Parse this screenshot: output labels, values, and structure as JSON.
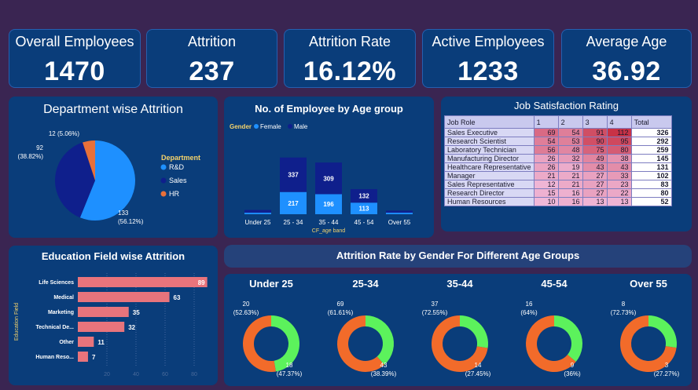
{
  "kpis": [
    {
      "label": "Overall Employees",
      "value": "1470"
    },
    {
      "label": "Attrition",
      "value": "237"
    },
    {
      "label": "Attrition Rate",
      "value": "16.12%"
    },
    {
      "label": "Active Employees",
      "value": "1233"
    },
    {
      "label": "Average Age",
      "value": "36.92"
    }
  ],
  "panels": {
    "dept": "Department wise Attrition",
    "age_group": "No. of Employee by Age group",
    "job_sat": "Job Satisfaction Rating",
    "edu": "Education Field wise Attrition",
    "gender_age": "Attrition Rate by Gender For Different Age Groups"
  },
  "colors": {
    "female": "#1e90ff",
    "male": "#0f1f8c",
    "hr": "#e8703a",
    "bar": "#e8747c",
    "donut_orange": "#f26b2a",
    "donut_green": "#5cf25c"
  },
  "chart_data": [
    {
      "id": "dept",
      "type": "pie",
      "legend_title": "Department",
      "legend_position": "right",
      "slices": [
        {
          "name": "R&D",
          "value": 133,
          "label": "133",
          "pct": "(56.12%)",
          "color": "#1e90ff"
        },
        {
          "name": "Sales",
          "value": 92,
          "label": "92",
          "pct": "(38.82%)",
          "color": "#0f1f8c"
        },
        {
          "name": "HR",
          "value": 12,
          "label": "12 (5.06%)",
          "pct": "",
          "color": "#e8703a"
        }
      ]
    },
    {
      "id": "age_group",
      "type": "bar",
      "stacked": true,
      "legend_title": "Gender",
      "legend_position": "top-left",
      "xlabel": "CF_age band",
      "categories": [
        "Under 25",
        "25 - 34",
        "35 - 44",
        "45 - 54",
        "Over 55"
      ],
      "series": [
        {
          "name": "Female",
          "color": "#1e90ff",
          "values": [
            15,
            217,
            196,
            113,
            15
          ]
        },
        {
          "name": "Male",
          "color": "#0f1f8c",
          "values": [
            27,
            337,
            309,
            132,
            20
          ]
        }
      ],
      "data_labels": [
        [
          "",
          "217",
          "196",
          "113",
          ""
        ],
        [
          "",
          "337",
          "309",
          "132",
          ""
        ]
      ]
    },
    {
      "id": "job_sat",
      "type": "table",
      "columns": [
        "Job Role",
        "1",
        "2",
        "3",
        "4",
        "Total"
      ],
      "rows": [
        [
          "Sales Executive",
          69,
          54,
          91,
          112,
          326
        ],
        [
          "Research Scientist",
          54,
          53,
          90,
          95,
          292
        ],
        [
          "Laboratory Technician",
          56,
          48,
          75,
          80,
          259
        ],
        [
          "Manufacturing Director",
          26,
          32,
          49,
          38,
          145
        ],
        [
          "Healthcare Representative",
          26,
          19,
          43,
          43,
          131
        ],
        [
          "Manager",
          21,
          21,
          27,
          33,
          102
        ],
        [
          "Sales Representative",
          12,
          21,
          27,
          23,
          83
        ],
        [
          "Research Director",
          15,
          16,
          27,
          22,
          80
        ],
        [
          "Human Resources",
          10,
          16,
          13,
          13,
          52
        ]
      ]
    },
    {
      "id": "edu",
      "type": "bar",
      "orientation": "horizontal",
      "ylabel": "Education Field",
      "categories": [
        "Life Sciences",
        "Medical",
        "Marketing",
        "Technical De...",
        "Other",
        "Human Reso..."
      ],
      "values": [
        89,
        63,
        35,
        32,
        11,
        7
      ],
      "xticks": [
        20,
        40,
        60,
        80
      ],
      "xlim": [
        0,
        89
      ]
    },
    {
      "id": "gender_age",
      "type": "pie",
      "donut": true,
      "groups": [
        {
          "title": "Under 25",
          "orange": 20,
          "orange_label": "20",
          "orange_pct": "(52.63%)",
          "green": 18,
          "green_label": "18",
          "green_pct": "(47.37%)"
        },
        {
          "title": "25-34",
          "orange": 69,
          "orange_label": "69",
          "orange_pct": "(61.61%)",
          "green": 43,
          "green_label": "43",
          "green_pct": "(38.39%)"
        },
        {
          "title": "35-44",
          "orange": 37,
          "orange_label": "37",
          "orange_pct": "(72.55%)",
          "green": 14,
          "green_label": "14",
          "green_pct": "(27.45%)"
        },
        {
          "title": "45-54",
          "orange": 16,
          "orange_label": "16",
          "orange_pct": "(64%)",
          "green": 9,
          "green_label": "9",
          "green_pct": "(36%)"
        },
        {
          "title": "Over 55",
          "orange": 8,
          "orange_label": "8",
          "orange_pct": "(72.73%)",
          "green": 3,
          "green_label": "3",
          "green_pct": "(27.27%)"
        }
      ]
    }
  ]
}
